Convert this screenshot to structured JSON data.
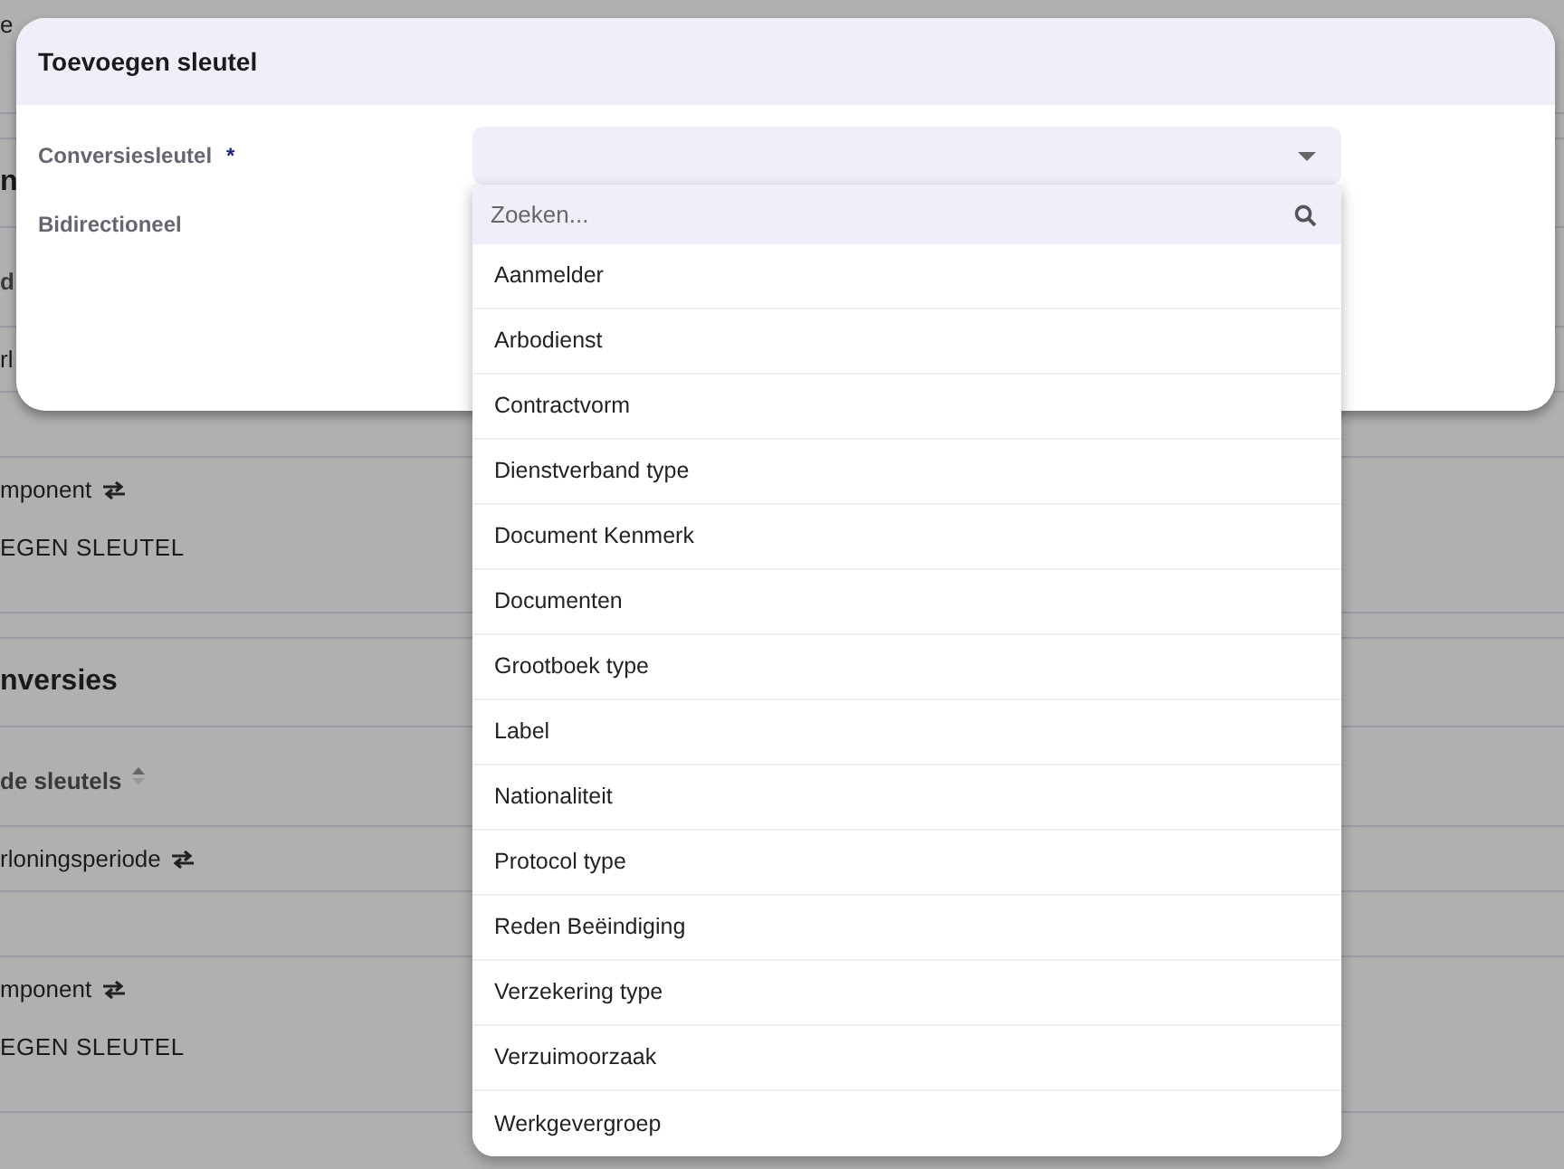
{
  "background": {
    "rows": [
      {
        "kind": "top",
        "lines": [
          {
            "text": "e"
          }
        ]
      },
      {
        "kind": "gap"
      },
      {
        "kind": "title",
        "lines": [
          {
            "text": "n"
          }
        ]
      },
      {
        "kind": "header",
        "lines": [
          {
            "text": "d"
          }
        ]
      },
      {
        "kind": "row",
        "lines": [
          {
            "text": "rl"
          }
        ]
      },
      {
        "kind": "row"
      },
      {
        "kind": "group",
        "lines": [
          {
            "text": "mponent",
            "swap": true
          },
          {
            "text": "EGEN SLEUTEL",
            "kind": "action"
          }
        ]
      },
      {
        "kind": "gap"
      },
      {
        "kind": "title",
        "lines": [
          {
            "text": "nversies"
          }
        ]
      },
      {
        "kind": "header",
        "lines": [
          {
            "text": "de sleutels",
            "sortable": true
          }
        ]
      },
      {
        "kind": "row",
        "lines": [
          {
            "text": "rloningsperiode",
            "swap": true
          }
        ]
      },
      {
        "kind": "row"
      },
      {
        "kind": "group",
        "lines": [
          {
            "text": "mponent",
            "swap": true
          },
          {
            "text": "EGEN SLEUTEL",
            "kind": "action"
          }
        ]
      }
    ]
  },
  "dialog": {
    "title": "Toevoegen sleutel",
    "fields": [
      {
        "label": "Conversiesleutel",
        "required_mark": "*"
      },
      {
        "label": "Bidirectioneel"
      }
    ]
  },
  "dropdown": {
    "expanded": true,
    "search_placeholder": "Zoeken...",
    "options": [
      {
        "label": "Aanmelder",
        "selected": false
      },
      {
        "label": "Arbodienst",
        "selected": false
      },
      {
        "label": "Contractvorm",
        "selected": false
      },
      {
        "label": "Dienstverband type",
        "selected": false
      },
      {
        "label": "Document Kenmerk",
        "selected": false
      },
      {
        "label": "Documenten",
        "selected": false
      },
      {
        "label": "Grootboek type",
        "selected": false
      },
      {
        "label": "Label",
        "selected": false
      },
      {
        "label": "Nationaliteit",
        "selected": false
      },
      {
        "label": "Protocol type",
        "selected": false
      },
      {
        "label": "Reden Beëindiging",
        "selected": false
      },
      {
        "label": "Verzekering type",
        "selected": false
      },
      {
        "label": "Verzuimoorzaak",
        "selected": false
      },
      {
        "label": "Werkgevergroep",
        "selected": false
      }
    ]
  }
}
